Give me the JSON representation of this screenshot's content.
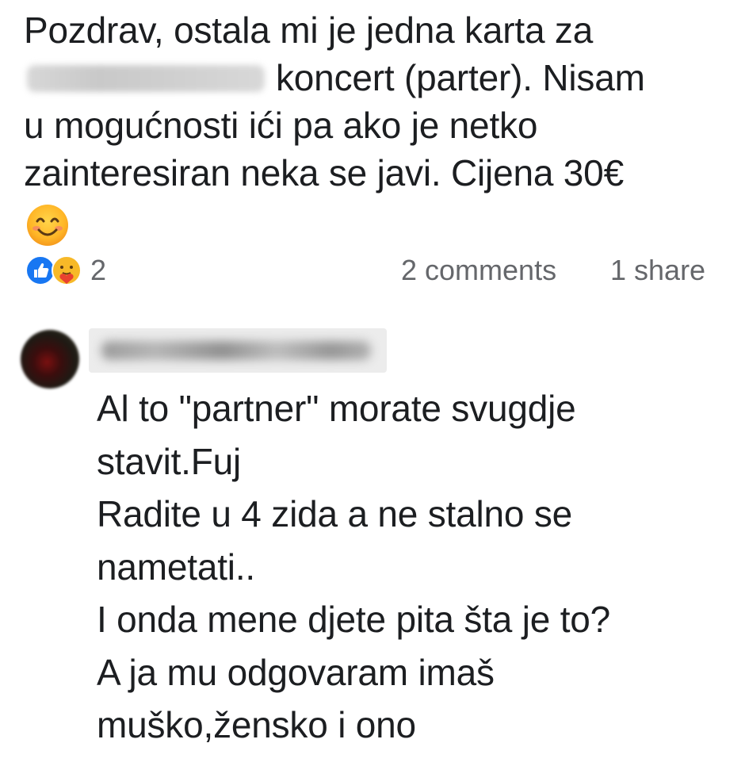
{
  "post": {
    "text_lines": [
      "Pozdrav, ostala mi je jedna karta za",
      "koncert (parter). Nisam",
      "u mogućnosti ići pa ako je netko",
      "zainteresiran neka se javi. Cijena 30€"
    ],
    "emoji": "smiling-face-icon"
  },
  "engagement": {
    "reaction_icons": [
      "like-icon",
      "care-icon"
    ],
    "reaction_count": "2",
    "comments": "2 comments",
    "shares": "1 share"
  },
  "comment": {
    "text_lines": [
      "Al to \"partner\" morate svugdje",
      "stavit.Fuj",
      "Radite u 4 zida a ne stalno se",
      "nametati..",
      "I onda mene djete pita šta je to?",
      "A ja mu odgovaram imaš",
      "muško,žensko i ono"
    ]
  },
  "colors": {
    "text": "#1c1e21",
    "meta": "#65676b",
    "like_blue": "#1877f2",
    "care_yellow": "#f7b928"
  }
}
